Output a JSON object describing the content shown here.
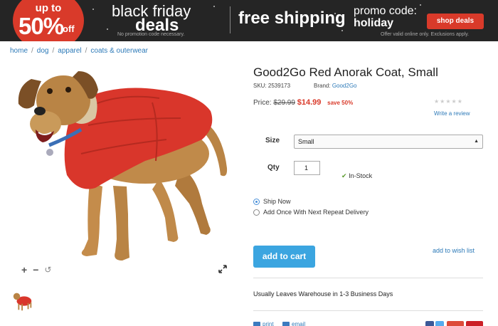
{
  "banner": {
    "badge_up": "up to",
    "badge_pct": "50%",
    "badge_off": "off",
    "title": "black friday",
    "deals": "deals",
    "no_code_note": "No promotion code necessary.",
    "free_shipping": "free shipping",
    "promo_label": "promo code:",
    "promo_code": "holiday",
    "shop_button": "shop deals",
    "offer_note": "Offer valid online only. Exclusions apply.",
    "accent_color": "#d93a2a"
  },
  "breadcrumb": {
    "items": [
      "home",
      "dog",
      "apparel",
      "coats & outerwear"
    ],
    "separator": "/"
  },
  "product": {
    "title": "Good2Go Red Anorak Coat, Small",
    "sku_label": "SKU: 2539173",
    "brand_label": "Brand:",
    "brand_name": "Good2Go",
    "price_label": "Price:",
    "old_price": "$29.99",
    "new_price": "$14.99",
    "save_text": "save 50%",
    "stars": "★★★★★",
    "review_link": "Write a review"
  },
  "options": {
    "size_label": "Size",
    "size_selected": "Small",
    "qty_label": "Qty",
    "qty_value": "1",
    "stock_text": "In-Stock"
  },
  "delivery": {
    "ship_now": "Ship Now",
    "repeat": "Add Once With Next Repeat Delivery"
  },
  "actions": {
    "add_to_cart": "add to cart",
    "wish_list": "add to wish list",
    "leaves_text": "Usually Leaves Warehouse in 1-3 Business Days"
  },
  "utility": {
    "print": "print",
    "email": "email"
  },
  "image_tools": {
    "zoom_in": "+",
    "zoom_out": "−",
    "reset": "↺"
  },
  "colors": {
    "link": "#2d7ab8",
    "cart_button": "#3ba5e0",
    "coat": "#d9362b"
  }
}
